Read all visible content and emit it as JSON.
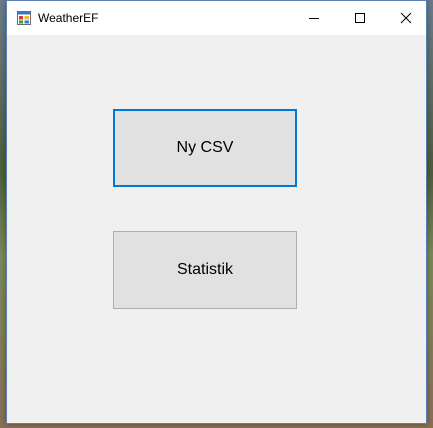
{
  "window": {
    "title": "WeatherEF",
    "app_icon": "form-icon",
    "caption_buttons": [
      "minimize-icon",
      "maximize-icon",
      "close-icon"
    ]
  },
  "main": {
    "buttons": [
      {
        "label": "Ny CSV",
        "focused": true
      },
      {
        "label": "Statistik",
        "focused": false
      }
    ]
  },
  "colors": {
    "focus_border": "#0078d7",
    "button_face": "#e1e1e1",
    "form_background": "#f0f0f0"
  }
}
